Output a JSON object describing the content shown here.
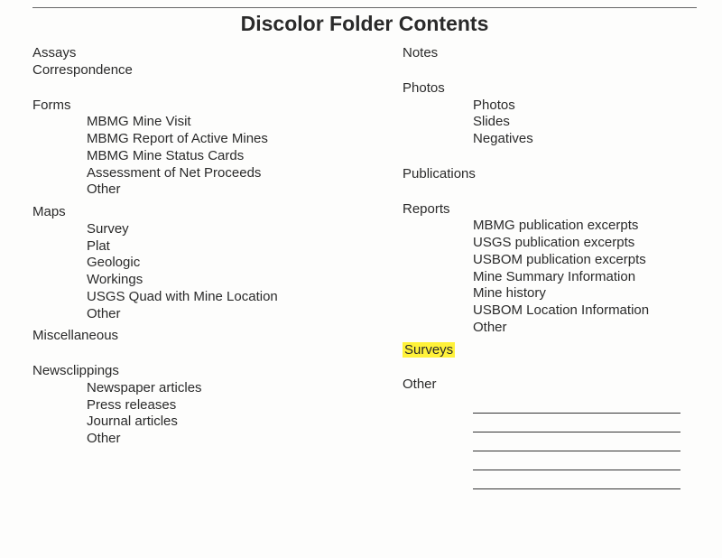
{
  "title": "Discolor Folder Contents",
  "left": {
    "assays": "Assays",
    "correspondence": "Correspondence",
    "forms": {
      "label": "Forms",
      "items": [
        "MBMG Mine Visit",
        "MBMG Report of Active Mines",
        "MBMG Mine Status Cards",
        "Assessment of Net Proceeds",
        "Other"
      ]
    },
    "maps": {
      "label": "Maps",
      "items": [
        "Survey",
        "Plat",
        "Geologic",
        "Workings",
        "USGS Quad with Mine Location",
        "Other"
      ]
    },
    "miscellaneous": "Miscellaneous",
    "newsclippings": {
      "label": "Newsclippings",
      "items": [
        "Newspaper articles",
        "Press releases",
        "Journal articles",
        "Other"
      ]
    }
  },
  "right": {
    "notes": "Notes",
    "photos": {
      "label": "Photos",
      "items": [
        "Photos",
        "Slides",
        "Negatives"
      ]
    },
    "publications": "Publications",
    "reports": {
      "label": "Reports",
      "items": [
        "MBMG publication excerpts",
        "USGS publication excerpts",
        "USBOM publication excerpts",
        "Mine Summary Information",
        "Mine history",
        "USBOM Location Information",
        "Other"
      ]
    },
    "surveys": "Surveys",
    "other": "Other"
  }
}
